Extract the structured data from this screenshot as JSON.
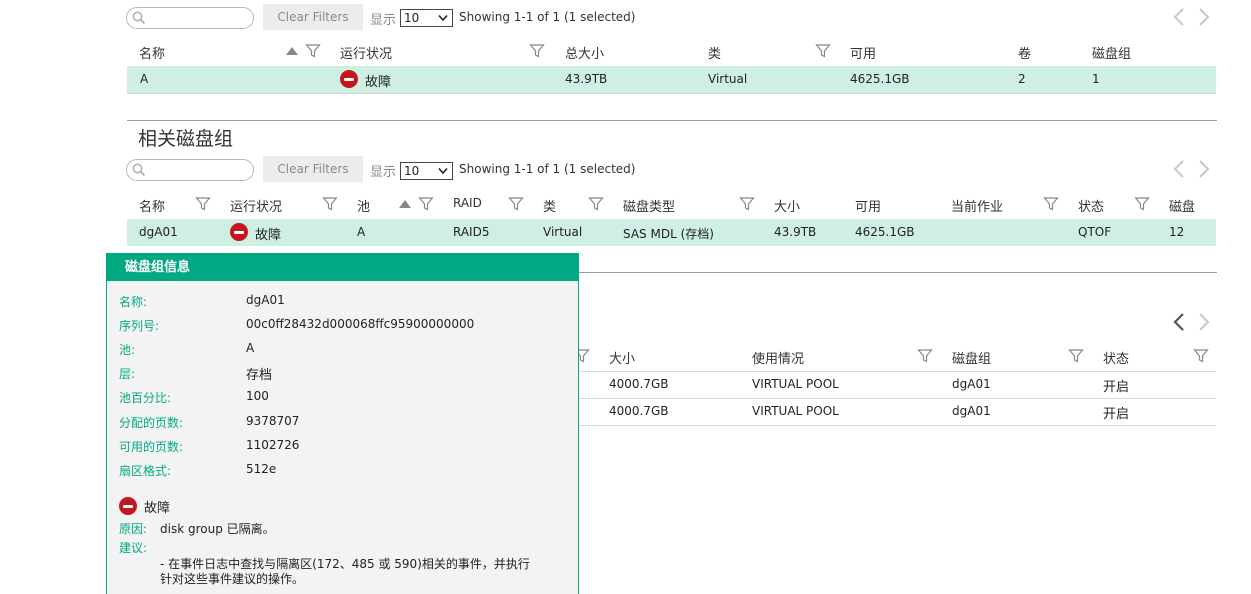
{
  "toolbar1": {
    "search_value": "",
    "clear_label": "Clear Filters",
    "show_label": "显示",
    "page_size": "10",
    "showing": "Showing 1-1 of 1 (1 selected)"
  },
  "pools_table": {
    "headers": [
      "名称",
      "运行状况",
      "总大小",
      "类",
      "可用",
      "卷",
      "磁盘组"
    ],
    "row": {
      "name": "A",
      "health": "故障",
      "total_size": "43.9TB",
      "class": "Virtual",
      "avail": "4625.1GB",
      "volumes": "2",
      "disk_groups": "1"
    }
  },
  "related_title": "相关磁盘组",
  "toolbar2": {
    "search_value": "",
    "clear_label": "Clear Filters",
    "show_label": "显示",
    "page_size": "10",
    "showing": "Showing 1-1 of 1 (1 selected)"
  },
  "dg_table": {
    "headers": [
      "名称",
      "运行状况",
      "池",
      "RAID",
      "类",
      "磁盘类型",
      "大小",
      "可用",
      "当前作业",
      "状态",
      "磁盘"
    ],
    "row": {
      "name": "dgA01",
      "health": "故障",
      "pool": "A",
      "raid": "RAID5",
      "class": "Virtual",
      "disk_type": "SAS MDL (存档)",
      "size": "43.9TB",
      "avail": "4625.1GB",
      "job": "",
      "status": "QTOF",
      "disks": "12"
    }
  },
  "vol_table": {
    "headers": [
      "大小",
      "使用情况",
      "磁盘组",
      "状态"
    ],
    "rows": [
      {
        "size": "4000.7GB",
        "usage": "VIRTUAL POOL",
        "dg": "dgA01",
        "status": "开启"
      },
      {
        "size": "4000.7GB",
        "usage": "VIRTUAL POOL",
        "dg": "dgA01",
        "status": "开启"
      }
    ]
  },
  "popup": {
    "title": "磁盘组信息",
    "fields": [
      {
        "k": "名称:",
        "v": "dgA01"
      },
      {
        "k": "序列号:",
        "v": "00c0ff28432d000068ffc95900000000"
      },
      {
        "k": "池:",
        "v": "A"
      },
      {
        "k": "层:",
        "v": "存档"
      },
      {
        "k": "池百分比:",
        "v": "100"
      },
      {
        "k": "分配的页数:",
        "v": "9378707"
      },
      {
        "k": "可用的页数:",
        "v": "1102726"
      },
      {
        "k": "扇区格式:",
        "v": "512e"
      }
    ],
    "health": "故障",
    "reason_label": "原因:",
    "reason": "disk group 已隔离。",
    "advice_label": "建议:",
    "advice_line1": "- 在事件日志中查找与隔离区(172、485 或 590)相关的事件，并执行",
    "advice_line2": "针对这些事件建议的操作。"
  },
  "colors": {
    "accent": "#01a982",
    "selected_row": "#cfefe3",
    "error": "#c4161c"
  }
}
